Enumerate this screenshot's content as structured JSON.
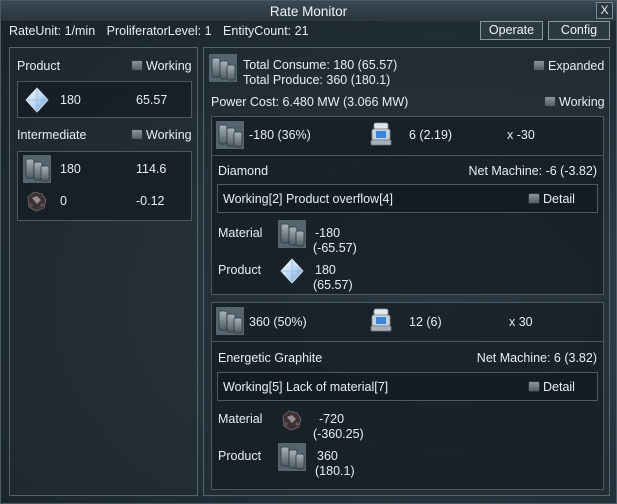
{
  "window": {
    "title": "Rate Monitor",
    "close_label": "X"
  },
  "status": {
    "rate_unit": "RateUnit: 1/min",
    "proliferator": "ProliferatorLevel: 1",
    "entity_count": "EntityCount: 21"
  },
  "buttons": {
    "operate": "Operate",
    "config": "Config"
  },
  "left": {
    "product_label": "Product",
    "product_working": "Working",
    "products": [
      {
        "icon": "diamond-icon",
        "count": "180",
        "rate": "65.57"
      }
    ],
    "intermediate_label": "Intermediate",
    "intermediate_working": "Working",
    "intermediates": [
      {
        "icon": "energetic-graphite-icon",
        "count": "180",
        "rate": "114.6"
      },
      {
        "icon": "coal-ore-icon",
        "count": "0",
        "rate": "-0.12"
      }
    ]
  },
  "right": {
    "total_consume": "Total Consume: 180 (65.57)",
    "total_produce": "Total Produce:   360 (180.1)",
    "expanded": "Expanded",
    "power_cost": "Power Cost: 6.480 MW (3.066 MW)",
    "working": "Working",
    "recipes": [
      {
        "item_icon": "energetic-graphite-icon",
        "rate": "-180 (36%)",
        "machine_icon": "assembler-icon",
        "machines": "6 (2.19)",
        "multiplier": "x -30",
        "name": "Diamond",
        "net_machine": "Net Machine: -6 (-3.82)",
        "status": "Working[2]  Product overflow[4]",
        "detail": "Detail",
        "material_label": "Material",
        "material_icon": "energetic-graphite-icon",
        "material_value": "-180",
        "material_sub": "(-65.57)",
        "product_label": "Product",
        "product_icon": "diamond-icon",
        "product_value": "180",
        "product_sub": "(65.57)"
      },
      {
        "item_icon": "energetic-graphite-icon",
        "rate": "360 (50%)",
        "machine_icon": "assembler-icon",
        "machines": "12 (6)",
        "multiplier": "x 30",
        "name": "Energetic Graphite",
        "net_machine": "Net Machine: 6 (3.82)",
        "status": "Working[5]  Lack of material[7]",
        "detail": "Detail",
        "material_label": "Material",
        "material_icon": "coal-ore-icon",
        "material_value": "-720",
        "material_sub": "(-360.25)",
        "product_label": "Product",
        "product_icon": "energetic-graphite-icon",
        "product_value": "360",
        "product_sub": "(180.1)"
      }
    ]
  }
}
